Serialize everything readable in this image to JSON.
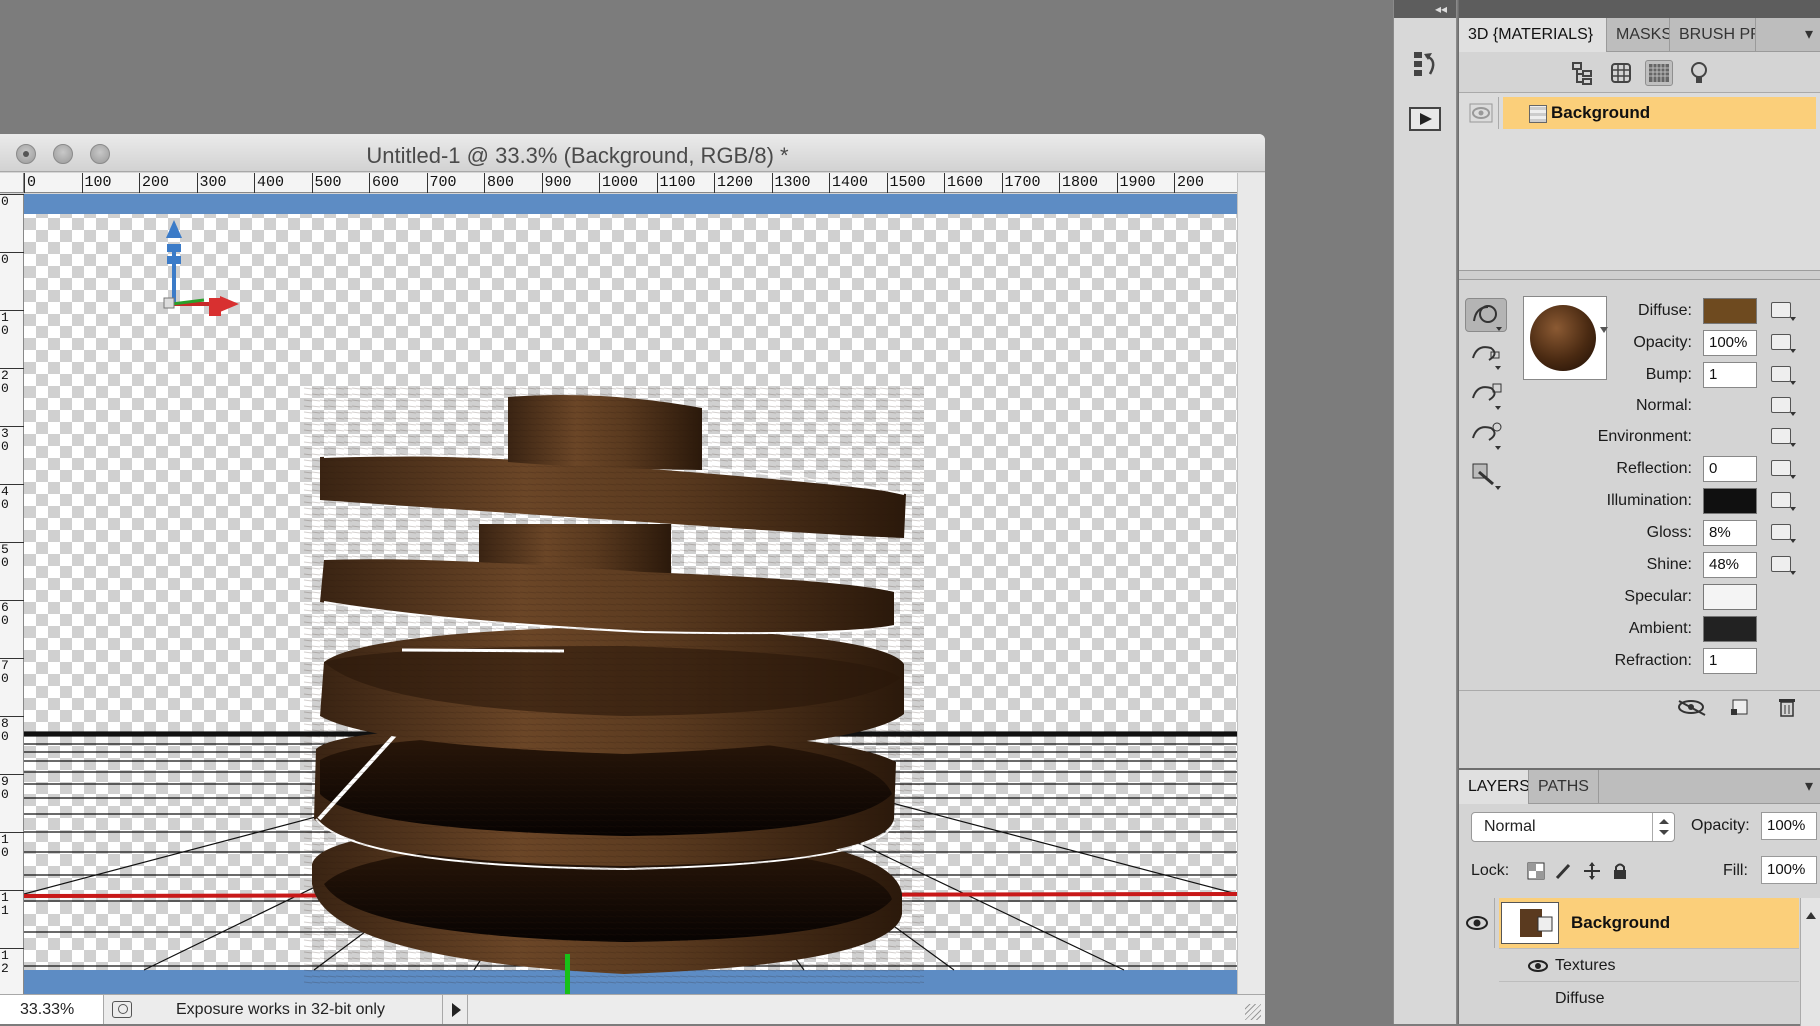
{
  "document": {
    "title": "Untitled-1 @ 33.3% (Background, RGB/8) *",
    "ruler_top_ticks": [
      "0",
      "100",
      "200",
      "300",
      "400",
      "500",
      "600",
      "700",
      "800",
      "900",
      "1000",
      "1100",
      "1200",
      "1300",
      "1400",
      "1500",
      "1600",
      "1700",
      "1800",
      "1900",
      "200"
    ],
    "ruler_left_ticks": [
      "0",
      "0",
      "1\n0",
      "2\n0",
      "3\n0",
      "4\n0",
      "5\n0",
      "6\n0",
      "7\n0",
      "8\n0",
      "9\n0",
      "1\n0",
      "1\n1",
      "1\n2"
    ],
    "zoom": "33.33%",
    "status_text": "Exposure works in 32-bit only"
  },
  "materials_panel": {
    "tabs": [
      "3D {MATERIALS}",
      "MASKS",
      "BRUSH PR"
    ],
    "material_name": "Background",
    "properties": [
      {
        "label": "Diffuse:",
        "kind": "swatch",
        "color": "#6e4a1f"
      },
      {
        "label": "Opacity:",
        "kind": "field",
        "value": "100%"
      },
      {
        "label": "Bump:",
        "kind": "field",
        "value": "1"
      },
      {
        "label": "Normal:",
        "kind": "none"
      },
      {
        "label": "Environment:",
        "kind": "none"
      },
      {
        "label": "Reflection:",
        "kind": "field",
        "value": "0"
      },
      {
        "label": "Illumination:",
        "kind": "swatch",
        "color": "#101010"
      },
      {
        "label": "Gloss:",
        "kind": "field",
        "value": "8%"
      },
      {
        "label": "Shine:",
        "kind": "field",
        "value": "48%"
      },
      {
        "label": "Specular:",
        "kind": "swatch",
        "color": "#f4f4f4"
      },
      {
        "label": "Ambient:",
        "kind": "swatch",
        "color": "#222222"
      },
      {
        "label": "Refraction:",
        "kind": "field",
        "value": "1"
      }
    ]
  },
  "layers_panel": {
    "tabs": [
      "LAYERS",
      "PATHS"
    ],
    "blend_mode": "Normal",
    "opacity_label": "Opacity:",
    "opacity_value": "100%",
    "lock_label": "Lock:",
    "fill_label": "Fill:",
    "fill_value": "100%",
    "layer_name": "Background",
    "sub_items": [
      "Textures",
      "Diffuse"
    ]
  },
  "colors": {
    "selection": "#fbcf7a",
    "wood_dark": "#1b0c04",
    "wood": "#5a3a1f",
    "canvas_band": "#5d8cc4"
  }
}
